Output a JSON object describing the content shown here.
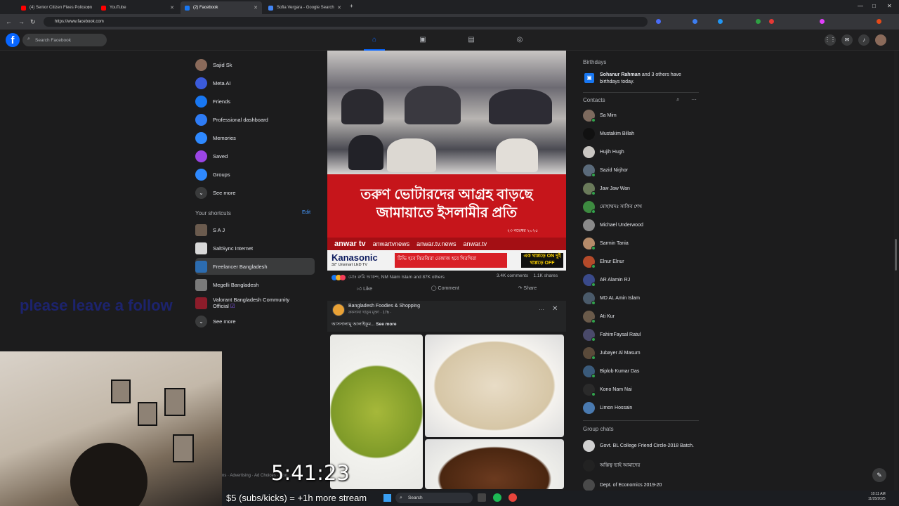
{
  "browser": {
    "tabs": [
      {
        "title": "(4) Senior Citizen Flees Police on",
        "color": "#ff0000"
      },
      {
        "title": "YouTube",
        "color": "#ff0000"
      },
      {
        "title": "(2) Facebook",
        "color": "#1877f2"
      },
      {
        "title": "Sofia Vergara - Google Search",
        "color": "#4285f4"
      }
    ],
    "new_tab": "+",
    "close": "✕",
    "url": "https://www.facebook.com"
  },
  "facebook": {
    "logo": "f",
    "search_placeholder": "Search Facebook",
    "nav_icons": [
      "home-icon",
      "video-icon",
      "marketplace-icon",
      "groups-icon"
    ],
    "left_menu": [
      {
        "label": "Sajid Sk",
        "icon": "avatar",
        "color": "#8a6a5a"
      },
      {
        "label": "Meta AI",
        "icon": "meta-ai-icon",
        "color": "#3b5bdb"
      },
      {
        "label": "Friends",
        "icon": "friends-icon",
        "color": "#1877f2"
      },
      {
        "label": "Professional dashboard",
        "icon": "dashboard-icon",
        "color": "#2e7cf6"
      },
      {
        "label": "Memories",
        "icon": "memories-icon",
        "color": "#2e89ff"
      },
      {
        "label": "Saved",
        "icon": "saved-icon",
        "color": "#9b45e4"
      },
      {
        "label": "Groups",
        "icon": "groups-icon",
        "color": "#2e89ff"
      },
      {
        "label": "See more",
        "icon": "chevron-down-icon",
        "color": "#3a3b3c"
      }
    ],
    "shortcuts_title": "Your shortcuts",
    "shortcuts_edit": "Edit",
    "shortcuts": [
      {
        "label": "S A J",
        "color": "#6b5b4e"
      },
      {
        "label": "SaltSync Internet",
        "color": "#d8d8d8"
      },
      {
        "label": "Freelancer Bangladesh",
        "color": "#2c6cb0"
      },
      {
        "label": "Megelli Bangladesh",
        "color": "#7a7a7a"
      },
      {
        "label": "Valorant Bangladesh Community",
        "label2": "Official",
        "color": "#8c1c2a"
      },
      {
        "label": "See more",
        "color": "#3a3b3c"
      }
    ]
  },
  "overlay": {
    "follow_text": "please leave a follow",
    "timer": "5:41:23",
    "stream_text": "$5 (subs/kicks) = +1h more stream",
    "footer": "ns · Advertising · Ad Choices · Coo..."
  },
  "post1": {
    "headline_l1": "তরুণ ভোটারদের আগ্রহ বাড়ছে",
    "headline_l2": "জামায়াতে ইসলামীর প্রতি",
    "date": "২৩ নভেম্বর ২০২৫",
    "strip": [
      "anwar tv",
      "anwartvnews",
      "anwar.tv.news",
      "anwar.tv"
    ],
    "ad_brand": "Kanasonic",
    "ad_sub": "32\" Unsmart LED TV",
    "ad_mid": "টিভি হবে ঝিরঝিরা  মেজাজ হবে খিরখিরা",
    "ad_right": "এক থাপ্পড়ে ON দুই থাপ্পড়ে OFF",
    "reactions_text": "মোঃ রুমি আকন্দ, NM Naim Islam and 87K others",
    "comments": "3.4K comments",
    "shares": "1.1K shares",
    "like": "Like",
    "comment": "Comment",
    "share": "Share"
  },
  "post2": {
    "title": "Bangladesh Foodies & Shopping",
    "subtitle": "রুকসানা খাতুন মুক্তা · 17h · ",
    "text": "আসসালামু আলাইকুম...",
    "see_more": "See more",
    "more": "···",
    "close": "✕"
  },
  "right": {
    "birthdays_title": "Birthdays",
    "birthday_name": "Sohanur Rahman",
    "birthday_text": " and 3 others have birthdays today.",
    "contacts_title": "Contacts",
    "contacts": [
      {
        "name": "Sa Mim",
        "color": "#7d6a5e",
        "online": true
      },
      {
        "name": "Mustakim Billah",
        "color": "#111111",
        "online": false
      },
      {
        "name": "Hujih Hugh",
        "color": "#c9c6c2",
        "online": false
      },
      {
        "name": "Sazid Nirjhor",
        "color": "#5a6a7a",
        "online": true
      },
      {
        "name": "Jaw Jaw Wan",
        "color": "#6a7a5a",
        "online": true
      },
      {
        "name": "মোহাম্মদঃ সাকিব শেখ",
        "color": "#3d8a40",
        "online": true
      },
      {
        "name": "Michael Underwood",
        "color": "#8a8a8a",
        "online": false
      },
      {
        "name": "Sarmin Tania",
        "color": "#b58b6a",
        "online": true
      },
      {
        "name": "Elnur Elnur",
        "color": "#b44a2a",
        "online": true
      },
      {
        "name": "AR Alamin RJ",
        "color": "#3a4a8a",
        "online": true
      },
      {
        "name": "MD AL Amin Islam",
        "color": "#4a5a6a",
        "online": true
      },
      {
        "name": "Ati Kur",
        "color": "#6a5a4a",
        "online": true
      },
      {
        "name": "FahimFaysal Ratul",
        "color": "#4a4a6a",
        "online": true
      },
      {
        "name": "Jubayer Al Masum",
        "color": "#5a4a3a",
        "online": true
      },
      {
        "name": "Biplob Kumar Das",
        "color": "#3a5a7a",
        "online": true
      },
      {
        "name": "Kono Nam Nai",
        "color": "#2a2a2a",
        "online": true
      },
      {
        "name": "Limon Hossain",
        "color": "#4a7ab0",
        "online": false
      }
    ],
    "group_chats_title": "Group chats",
    "group_chats": [
      {
        "name": "Govt. BL College Friend Circle-2018 Batch.",
        "color": "#d0d0d0"
      },
      {
        "name": "অস্তিত্ব ভাই আমাদের",
        "color": "#222222"
      },
      {
        "name": "Dept. of Economics 2019-20",
        "color": "#4a4a4a"
      }
    ]
  },
  "taskbar": {
    "search": "Search",
    "time": "10:11 AM",
    "date": "11/25/2025"
  }
}
